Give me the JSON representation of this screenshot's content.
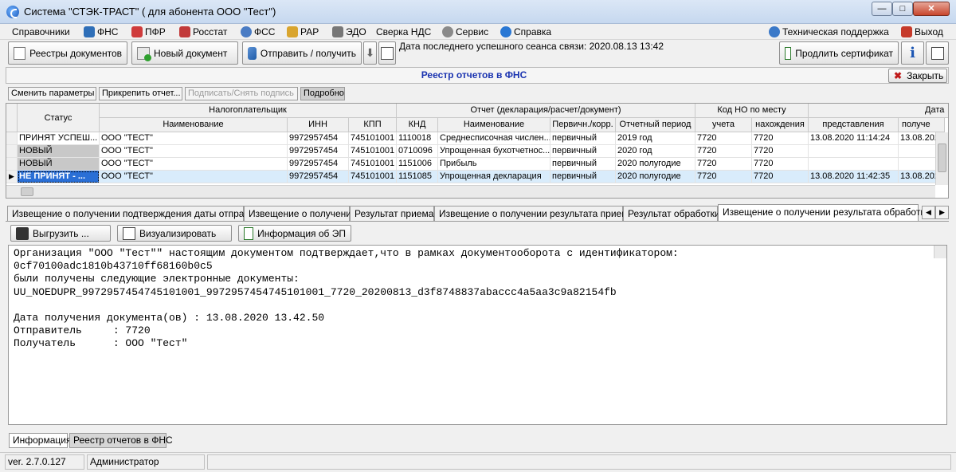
{
  "window": {
    "title": "Система \"СТЭК-ТРАСТ\" ( для абонента ООО \"Тест\")",
    "min": "—",
    "max": "□",
    "close": "✕"
  },
  "menu": {
    "items": [
      "Справочники",
      "ФНС",
      "ПФР",
      "Росстат",
      "ФСС",
      "РАР",
      "ЭДО",
      "Сверка НДС",
      "Сервис",
      "Справка"
    ],
    "support": "Техническая поддержка",
    "exit": "Выход"
  },
  "toolbar": {
    "registries": "Реестры документов",
    "new_doc": "Новый документ",
    "send_receive": "Отправить / получить",
    "last_session": "Дата последнего успешного сеанса связи: 2020.08.13 13:42",
    "extend_cert": "Продлить сертификат",
    "info_glyph": "i"
  },
  "panel": {
    "title": "Реестр отчетов в ФНС",
    "close": "Закрыть"
  },
  "actions": [
    "Сменить параметры",
    "Прикрепить отчет...",
    "Подписать/Снять подпись",
    "Подробно"
  ],
  "grid": {
    "group_headers": {
      "taxpayer": "Налогоплательщик",
      "report": "Отчет (декларация/расчет/документ)",
      "code": "Код НО по месту",
      "date": "Дата"
    },
    "columns": [
      "Статус",
      "Наименование",
      "ИНН",
      "КПП",
      "КНД",
      "Наименование",
      "Первичн./корр.",
      "Отчетный период",
      "учета",
      "нахождения",
      "представления",
      "получе"
    ],
    "rows": [
      [
        "ПРИНЯТ УСПЕШ...",
        "ООО \"ТЕСТ\"",
        "9972957454",
        "745101001",
        "1110018",
        "Среднесписочная числен...",
        "первичный",
        "2019 год",
        "7720",
        "7720",
        "13.08.2020 11:14:24",
        "13.08.202"
      ],
      [
        "НОВЫЙ",
        "ООО \"ТЕСТ\"",
        "9972957454",
        "745101001",
        "0710096",
        "Упрощенная бухотчетнос...",
        "первичный",
        "2020 год",
        "7720",
        "7720",
        "",
        ""
      ],
      [
        "НОВЫЙ",
        "ООО \"ТЕСТ\"",
        "9972957454",
        "745101001",
        "1151006",
        "Прибыль",
        "первичный",
        "2020 полугодие",
        "7720",
        "7720",
        "",
        ""
      ],
      [
        "НЕ ПРИНЯТ - ...",
        "ООО \"ТЕСТ\"",
        "9972957454",
        "745101001",
        "1151085",
        "Упрощенная декларация",
        "первичный",
        "2020 полугодие",
        "7720",
        "7720",
        "13.08.2020 11:42:35",
        "13.08.202"
      ]
    ]
  },
  "tabs": [
    "Извещение о получении подтверждения даты отправки",
    "Извещение о получении",
    "Результат приема",
    "Извещение о получении результата приема",
    "Результат обработки",
    "Извещение о получении результата обработки"
  ],
  "tab_nav": {
    "prev": "◀",
    "next": "▶"
  },
  "doc_buttons": {
    "export": "Выгрузить ...",
    "visualize": "Визуализировать",
    "sig_info": "Информация об ЭП"
  },
  "message_lines": [
    "Организация \"ООО \"Тест\"\" настоящим документом подтверждает,что в рамках документооборота с идентификатором:",
    "0cf70100adc1810b43710ff68160b0c5",
    "были получены следующие электронные документы:",
    "UU_NOEDUPR_9972957454745101001_9972957454745101001_7720_20200813_d3f8748837abaccc4a5aa3c9a82154fb",
    "",
    "Дата получения документа(ов) : 13.08.2020 13.42.50",
    "Отправитель     : 7720",
    "Получатель      : ООО \"Тест\""
  ],
  "bottom_tabs": [
    "Информация",
    "Реестр отчетов в ФНС"
  ],
  "status": {
    "version": "ver. 2.7.0.127",
    "user": "Администратор"
  }
}
